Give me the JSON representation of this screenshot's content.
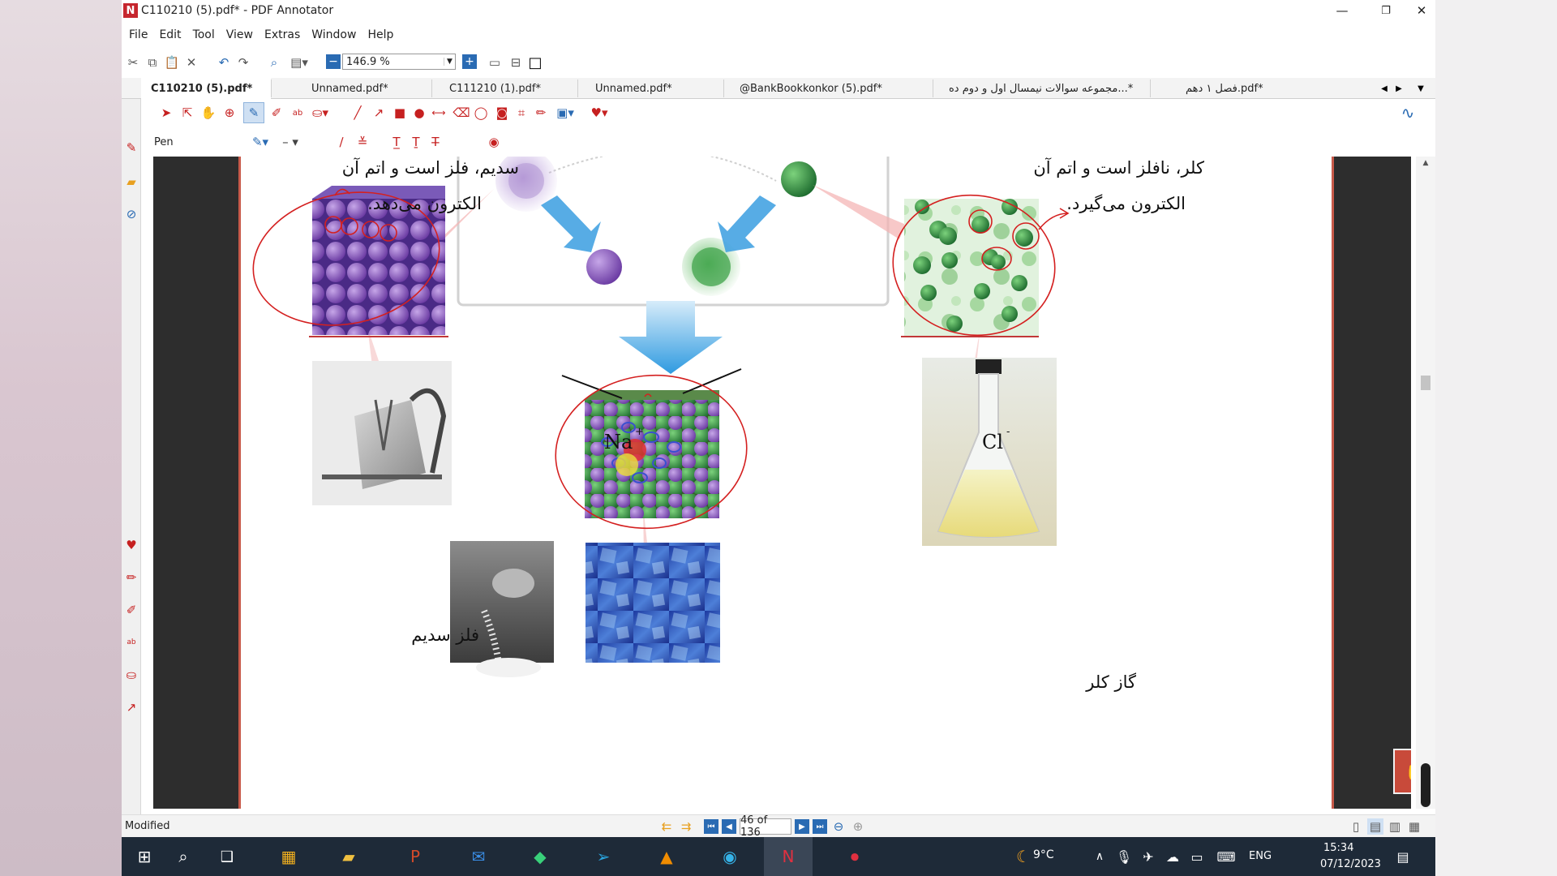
{
  "app": {
    "title": "C110210 (5).pdf* - PDF Annotator",
    "min": "—",
    "max": "❐",
    "close": "✕"
  },
  "menu": [
    "File",
    "Edit",
    "Tool",
    "View",
    "Extras",
    "Window",
    "Help"
  ],
  "toolbar": {
    "zoom": "146.9 %"
  },
  "tabs": [
    "C110210 (5).pdf*",
    "Unnamed.pdf*",
    "C111210 (1).pdf*",
    "Unnamed.pdf*",
    "@BankBookkonkor (5).pdf*",
    "مجموعه سوالات نیمسال اول و دوم ده...*",
    "فصل ۱ دهم.pdf*"
  ],
  "tool_label": "Pen",
  "page": {
    "sodium_line1": "سدیم، فلز است و اتم آن",
    "sodium_line2": "الکترون می‌دهد.",
    "chlorine_line1": "کلر، نافلز است و اتم آن",
    "chlorine_line2": "الکترون می‌گیرد.",
    "na_label": "Na",
    "na_sup": "+",
    "cl_label": "Cl",
    "cl_sup": "-",
    "sodium_metal_caption": "فلز سدیم",
    "chlorine_gas_caption": "گاز کلر"
  },
  "status": {
    "modified": "Modified",
    "page": "46 of 136"
  },
  "taskbar": {
    "weather": "9°C",
    "lang": "ENG",
    "time": "15:34",
    "date": "07/12/2023"
  },
  "colors": {
    "accent": "#2a6bb3",
    "annotation": "#d42020",
    "brand": "#c6262e"
  }
}
